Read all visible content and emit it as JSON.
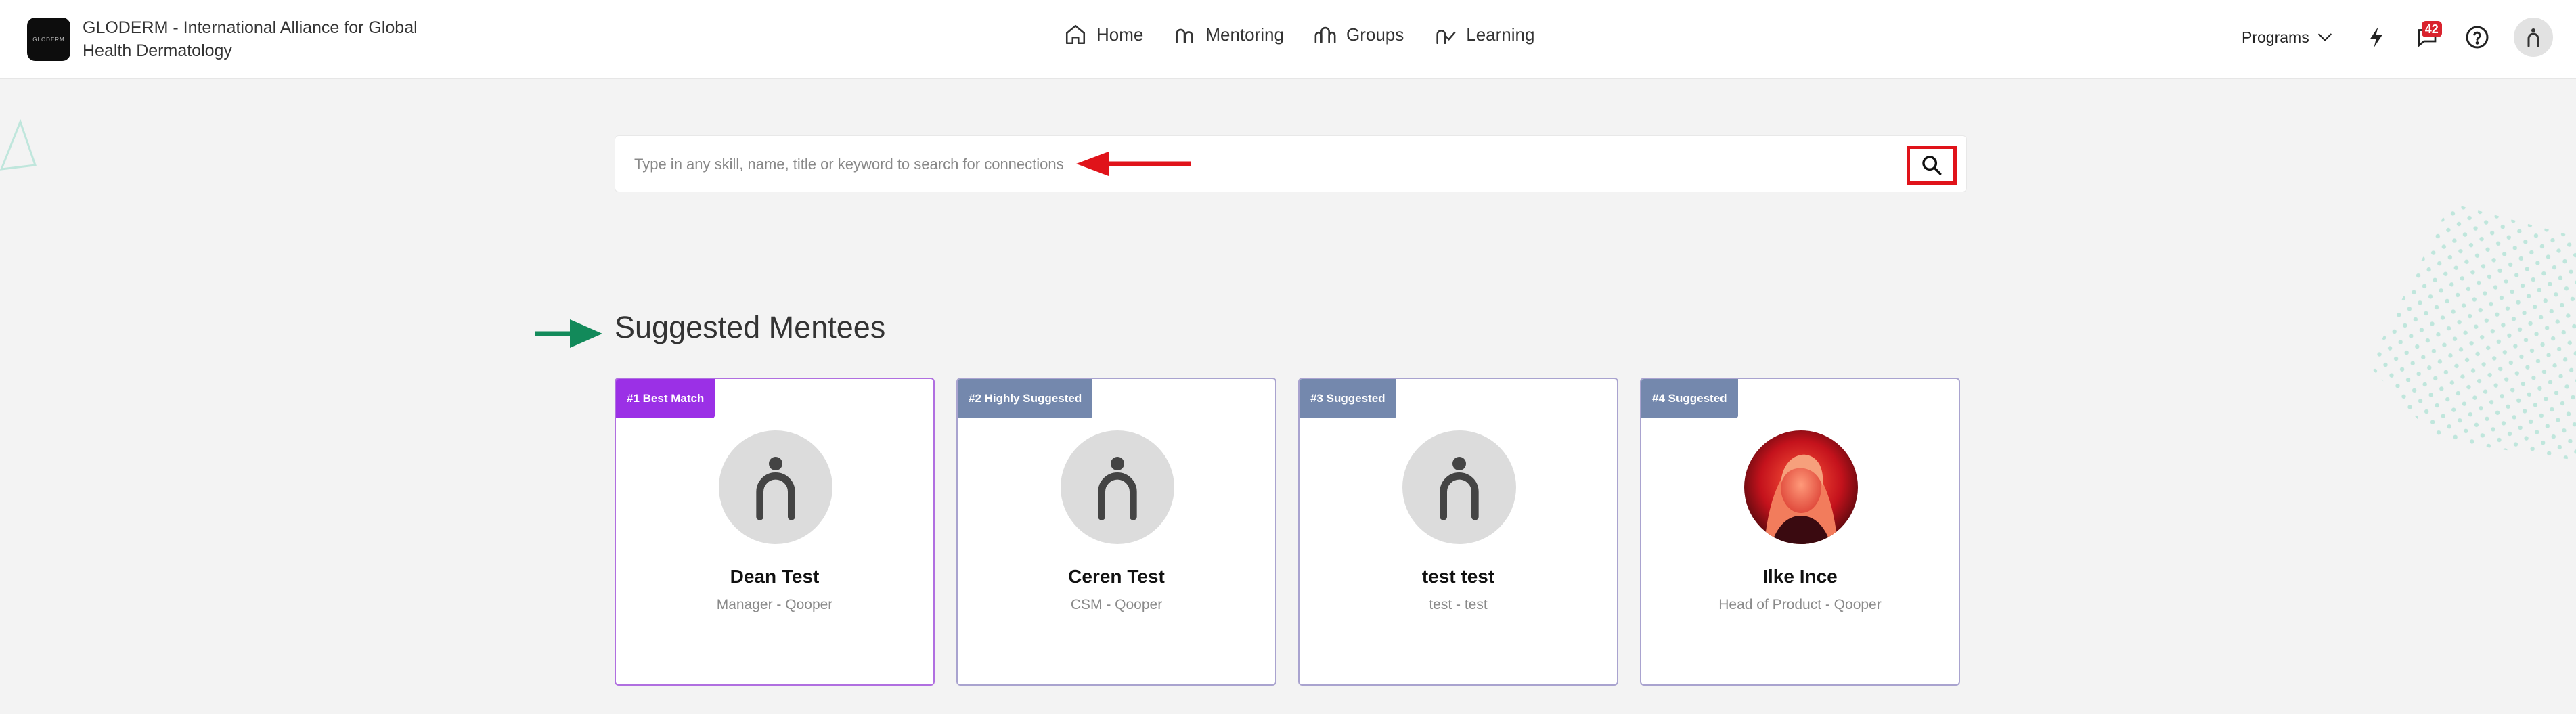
{
  "header": {
    "brand_logo_text": "GLODERM",
    "brand_title": "GLODERM - International Alliance for Global Health Dermatology",
    "nav": [
      {
        "label": "Home",
        "icon": "home-icon"
      },
      {
        "label": "Mentoring",
        "icon": "mentoring-icon"
      },
      {
        "label": "Groups",
        "icon": "groups-icon"
      },
      {
        "label": "Learning",
        "icon": "learning-icon"
      }
    ],
    "programs_label": "Programs",
    "notifications_count": "42",
    "icons": [
      "chevron-down-icon",
      "lightning-icon",
      "notification-icon",
      "help-icon",
      "user-avatar-icon"
    ]
  },
  "search": {
    "placeholder": "Type in any skill, name, title or keyword to search for connections",
    "value": "",
    "button_icon": "search-icon"
  },
  "section": {
    "title": "Suggested Mentees"
  },
  "mentees": [
    {
      "rank": "#1 Best Match",
      "name": "Dean Test",
      "role": "Manager - Qooper",
      "badge_color": "#9b30e6",
      "photo": false
    },
    {
      "rank": "#2 Highly Suggested",
      "name": "Ceren Test",
      "role": "CSM - Qooper",
      "badge_color": "#7488ad",
      "photo": false
    },
    {
      "rank": "#3 Suggested",
      "name": "test test",
      "role": "test - test",
      "badge_color": "#7488ad",
      "photo": false
    },
    {
      "rank": "#4 Suggested",
      "name": "Ilke Ince",
      "role": "Head of Product - Qooper",
      "badge_color": "#7488ad",
      "photo": true
    }
  ],
  "colors": {
    "annotation_red": "#e0131a",
    "annotation_green": "#128a5a",
    "best_match_purple": "#9b30e6",
    "suggested_slate": "#7488ad"
  }
}
